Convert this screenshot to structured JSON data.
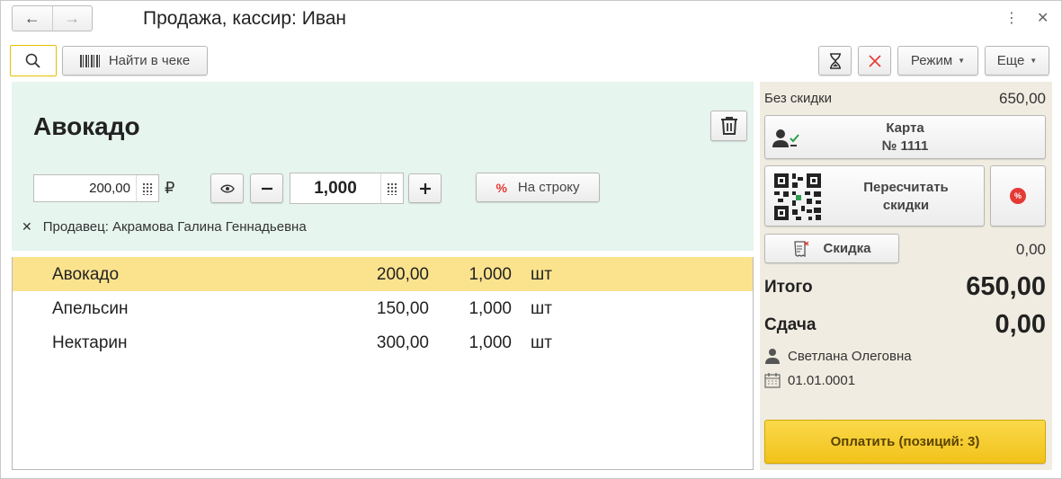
{
  "window": {
    "title": "Продажа, кассир: Иван"
  },
  "nav": {
    "back": "←",
    "forward": "→"
  },
  "window_controls": {
    "menu": "⋮",
    "close": "✕"
  },
  "toolbar": {
    "find_label": "Найти в чеке",
    "mode_label": "Режим",
    "more_label": "Еще"
  },
  "product": {
    "title": "Авокадо",
    "price": "200,00",
    "currency": "₽",
    "quantity": "1,000",
    "to_row_label": "На строку",
    "seller": "Продавец: Акрамова Галина Геннадьевна"
  },
  "items": [
    {
      "name": "Авокадо",
      "price": "200,00",
      "qty": "1,000",
      "unit": "шт",
      "selected": true
    },
    {
      "name": "Апельсин",
      "price": "150,00",
      "qty": "1,000",
      "unit": "шт",
      "selected": false
    },
    {
      "name": "Нектарин",
      "price": "300,00",
      "qty": "1,000",
      "unit": "шт",
      "selected": false
    }
  ],
  "summary": {
    "no_discount_label": "Без скидки",
    "no_discount_value": "650,00",
    "card_line1": "Карта",
    "card_line2": "№ 1111",
    "recalc_label": "Пересчитать\nскидки",
    "discount_label": "Скидка",
    "discount_value": "0,00",
    "total_label": "Итого",
    "total_value": "650,00",
    "change_label": "Сдача",
    "change_value": "0,00",
    "customer": "Светлана Олеговна",
    "date": "01.01.0001",
    "pay_label": "Оплатить (позиций: 3)"
  },
  "colors": {
    "product_panel_bg": "#e6f5ee",
    "selected_row_bg": "#fbe38e",
    "right_panel_bg": "#f1ece1",
    "pay_button": "#f4c92a",
    "accent_red": "#e53935"
  }
}
